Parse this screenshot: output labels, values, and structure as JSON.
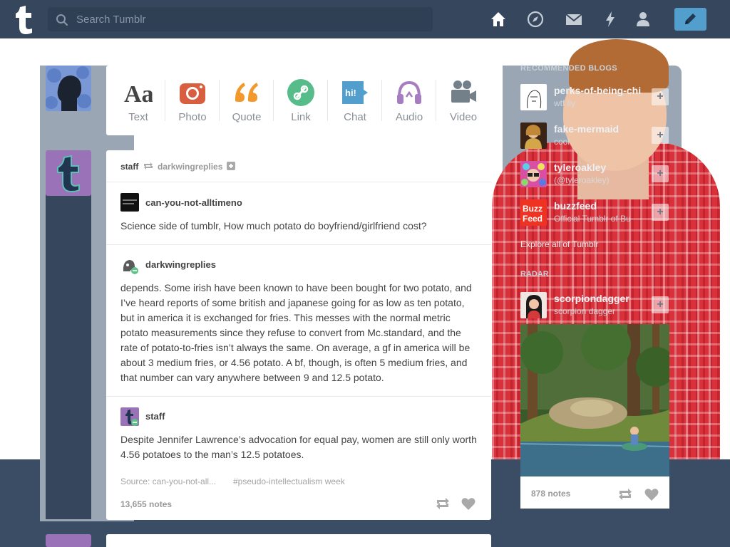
{
  "search": {
    "placeholder": "Search Tumblr"
  },
  "nav": {
    "items": [
      "home-icon",
      "explore-icon",
      "inbox-icon",
      "activity-icon",
      "account-icon"
    ],
    "compose_icon": "pencil-icon"
  },
  "composer": {
    "types": [
      {
        "label": "Text",
        "icon": "text-icon",
        "color": "#444444"
      },
      {
        "label": "Photo",
        "icon": "camera-icon",
        "color": "#d95e40"
      },
      {
        "label": "Quote",
        "icon": "quote-icon",
        "color": "#f2992e"
      },
      {
        "label": "Link",
        "icon": "link-icon",
        "color": "#56bc8a"
      },
      {
        "label": "Chat",
        "icon": "chat-icon",
        "color": "#529ecc"
      },
      {
        "label": "Audio",
        "icon": "headphones-icon",
        "color": "#a77dc2"
      },
      {
        "label": "Video",
        "icon": "video-camera-icon",
        "color": "#748089"
      }
    ]
  },
  "post": {
    "reblogger": "staff",
    "reblogged_from": "darkwingreplies",
    "entries": [
      {
        "user": "can-you-not-alltimeno",
        "text": "Science side of tumblr, How much potato do boyfriend/girlfriend cost?"
      },
      {
        "user": "darkwingreplies",
        "text": "depends. Some irish have been known to have been bought for two potato, and I’ve heard reports of some british and japanese going for as low as ten potato, but in america it is exchanged for fries. This messes with the normal metric potato measurements since they refuse to convert from Mc.standard, and the rate of potato-to-fries isn’t always the same. On average, a gf in america will be about 3 medium fries, or 4.56 potato. A bf, though, is often 5 medium fries, and that number can vary anywhere between 9 and 12.5 potato."
      },
      {
        "user": "staff",
        "text": "Despite Jennifer Lawrence’s advocation for equal pay, women are still only worth 4.56 potatoes to the man’s 12.5 potatoes."
      }
    ],
    "source": "Source: can-you-not-all...",
    "tag": "#pseudo-intellectualism week",
    "notes": "13,655 notes"
  },
  "sidebar": {
    "recommended_title": "RECOMMENDED BLOGS",
    "blogs": [
      {
        "name": "perks-of-being-chi",
        "sub": "wtf lly"
      },
      {
        "name": "fake-mermaid",
        "sub": "cool"
      },
      {
        "name": "tyleroakley",
        "sub": "(@tyleroakley)"
      },
      {
        "name": "buzzfeed",
        "sub": "Official Tumblr of Bu"
      }
    ],
    "buzzfeed_logo_text": "Buzz Feed",
    "explore": "Explore all of Tumblr",
    "radar_title": "RADAR",
    "radar": {
      "name": "scorpiondagger",
      "sub": "scorpion dagger",
      "notes": "878 notes"
    }
  }
}
